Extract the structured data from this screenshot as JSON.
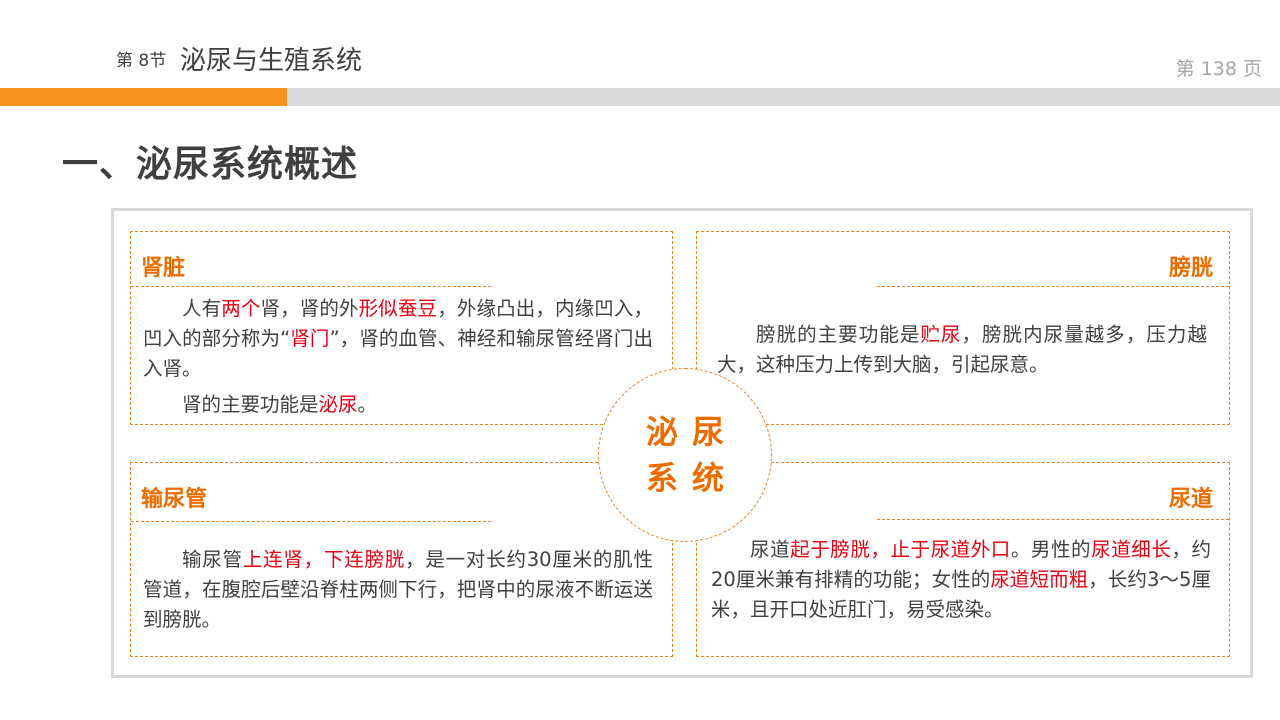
{
  "header": {
    "chapter_number": "第 8节",
    "chapter_title": "泌尿与生殖系统",
    "page_number": "第 138 页"
  },
  "section_heading": "一、泌尿系统概述",
  "center": {
    "line1": "泌尿",
    "line2": "系统"
  },
  "cards": {
    "kidney": {
      "title": "肾脏",
      "p1": [
        "人有",
        "两个",
        "肾，肾的外",
        "形似蚕豆",
        "，外缘凸出，内缘凹入，凹入的部分称为“",
        "肾门",
        "”，肾的血管、神经和输尿管经肾门出入肾。"
      ],
      "p2": [
        "肾的主要功能是",
        "泌尿",
        "。"
      ]
    },
    "bladder": {
      "title": "膀胱",
      "p1": [
        "膀胱的主要功能是",
        "贮尿",
        "，膀胱内尿量越多，压力越大，这种压力上传到大脑，引起尿意。"
      ]
    },
    "ureter": {
      "title": "输尿管",
      "p1": [
        "输尿管",
        "上连肾，下连膀胱",
        "，是一对长约30厘米的肌性管道，在腹腔后壁沿脊柱两侧下行，把肾中的尿液不断运送到膀胱。"
      ]
    },
    "urethra": {
      "title": "尿道",
      "p1": [
        "尿道",
        "起于膀胱，止于尿道外口",
        "。男性的",
        "尿道细长",
        "，约20厘米兼有排精的功能；女性的",
        "尿道短而粗",
        "，长约3～5厘米，且开口处近肛门，易受感染。"
      ]
    }
  },
  "colors": {
    "accent_orange": "#ed6c00",
    "highlight_red": "#e60012",
    "bar_gray": "#d9d9d9"
  }
}
